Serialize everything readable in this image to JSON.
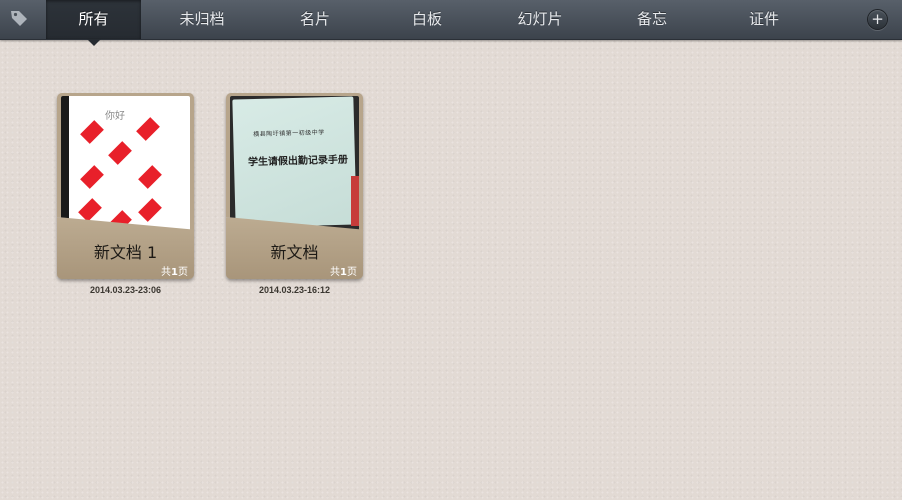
{
  "toolbar": {
    "tag_icon": "tag-icon",
    "tabs": [
      {
        "label": "所有",
        "active": true
      },
      {
        "label": "未归档",
        "active": false
      },
      {
        "label": "名片",
        "active": false
      },
      {
        "label": "白板",
        "active": false
      },
      {
        "label": "幻灯片",
        "active": false
      },
      {
        "label": "备忘",
        "active": false
      },
      {
        "label": "证件",
        "active": false
      }
    ],
    "add_label": "+",
    "add_icon": "plus-icon"
  },
  "documents": [
    {
      "title": "新文档 1",
      "pages_prefix": "共",
      "pages_count": "1",
      "pages_suffix": "页",
      "date": "2014.03.23-23:06",
      "thumbnail": {
        "kind": "playing-card",
        "caption": "你好"
      }
    },
    {
      "title": "新文档",
      "pages_prefix": "共",
      "pages_count": "1",
      "pages_suffix": "页",
      "date": "2014.03.23-16:12",
      "thumbnail": {
        "kind": "booklet",
        "line1": "横县陶圩镇第一初级中学",
        "line2": "学生请假出勤记录手册"
      }
    }
  ],
  "colors": {
    "toolbar_top": "#58606a",
    "toolbar_bottom": "#3c434c",
    "background": "#e2dad4",
    "card": "#b7a58b"
  }
}
